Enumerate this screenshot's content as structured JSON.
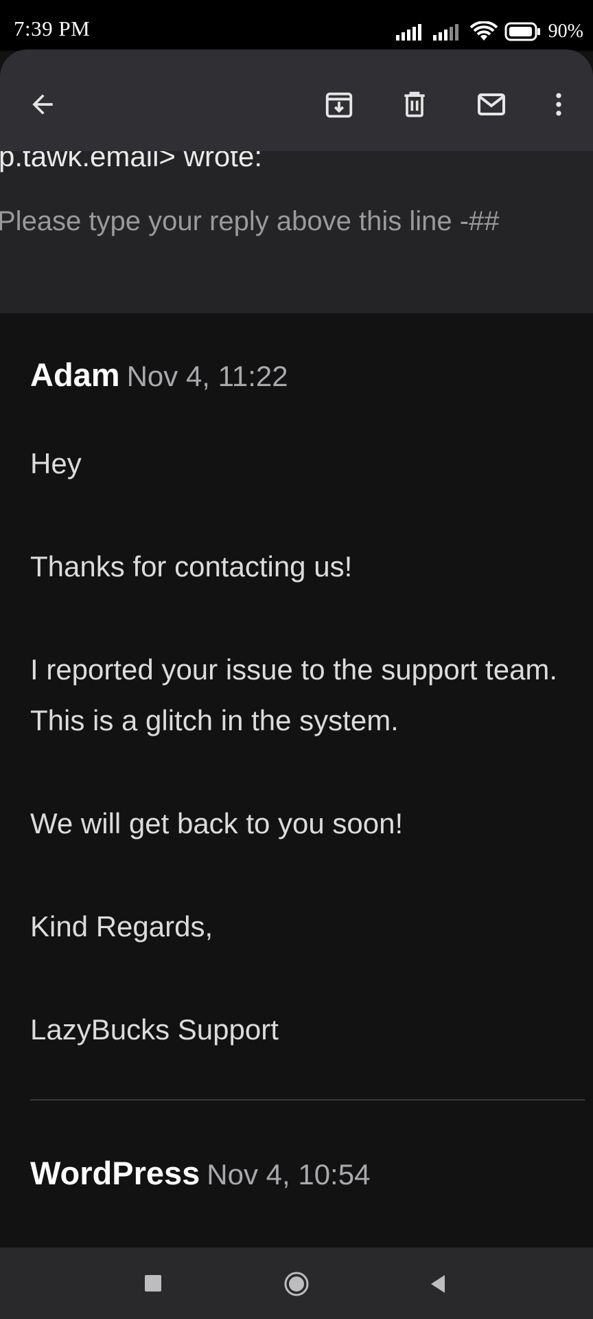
{
  "status_bar": {
    "time": "7:39 PM",
    "battery": "90%"
  },
  "app_bar": {
    "back_icon": "arrow-left-icon",
    "actions": [
      "archive-icon",
      "delete-icon",
      "mark-unread-icon",
      "more-vert-icon"
    ]
  },
  "quoted": {
    "line1": "p.tawk.email> wrote:",
    "line2": "Please type your reply above this line -##"
  },
  "messages": [
    {
      "sender": "Adam",
      "time": "Nov 4, 11:22",
      "body": [
        "Hey",
        "Thanks for contacting us!",
        "I reported your issue to the support team. This is a glitch in the system.",
        "We will get back to you soon!",
        "Kind Regards,",
        "LazyBucks Support"
      ]
    },
    {
      "sender": "WordPress",
      "time": "Nov 4, 10:54"
    }
  ],
  "colors": {
    "background": "#121213",
    "app_bar": "#303034",
    "quoted_bg": "#242427",
    "nav_bar": "#29292c"
  }
}
